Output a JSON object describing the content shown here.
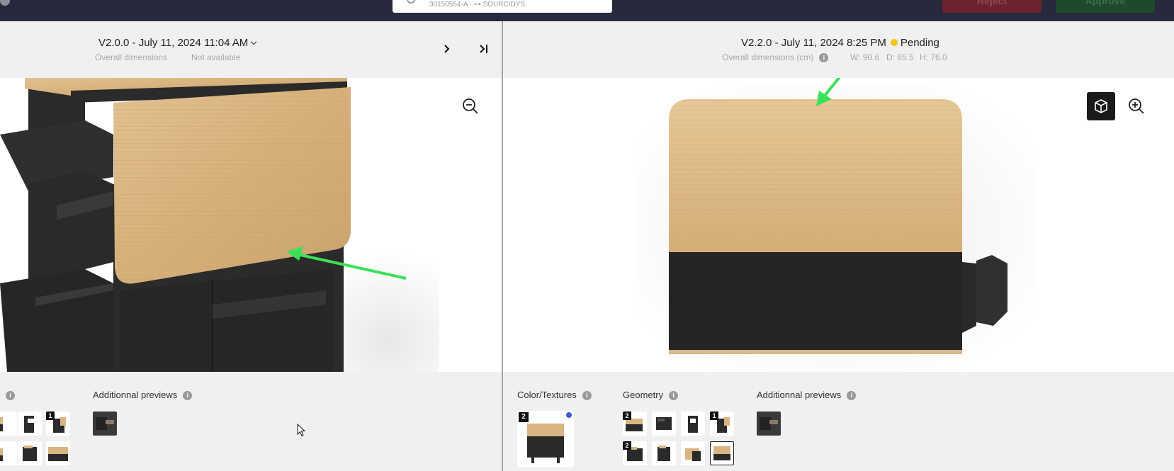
{
  "topbar": {
    "search_text": "30150554-A  ·  ⊶ SOURCIDYS",
    "reject_label": "Reject",
    "approve_label": "Approve"
  },
  "left": {
    "version": "V2.0.0 - July 11, 2024 11:04 AM",
    "dims_label": "Overall dimensions",
    "dims_value": "Not available",
    "sections": {
      "additional_previews": "Additionnal previews"
    }
  },
  "right": {
    "version": "V2.2.0 - July 11, 2024 8:25 PM",
    "status": "Pending",
    "dims_label": "Overall dimensions (cm)",
    "dims": {
      "w": "W: 90.6",
      "d": "D: 65.5",
      "h": "H: 76.0"
    },
    "sections": {
      "color_textures": "Color/Textures",
      "geometry": "Geometry",
      "additional_previews": "Additionnal previews"
    },
    "badges": {
      "color": "2",
      "geo1": "2",
      "geo4": "1",
      "geo5": "2"
    }
  },
  "left_badges": {
    "t3": "1"
  },
  "info_glyph": "i",
  "colors": {
    "topbar": "#262a3c",
    "status_pending": "#f5c518",
    "arrow": "#3be05a",
    "wood": "#d9b582",
    "black": "#2a2a2a"
  }
}
